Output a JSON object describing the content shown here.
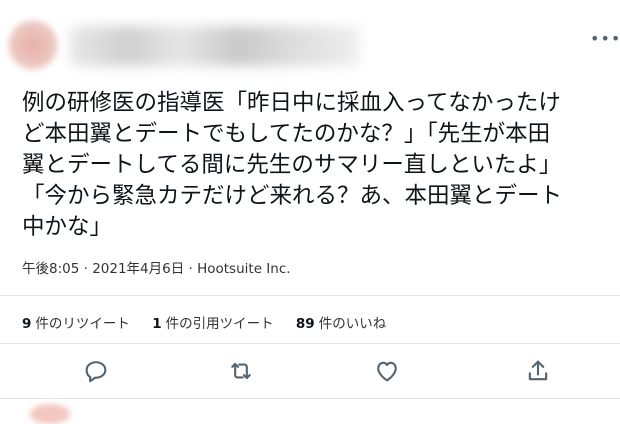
{
  "tweet": {
    "text_lines": [
      "例の研修医の指導医「昨日中に採血入ってなかったけ",
      "ど本田翼とデートでもしてたのかな？」「先生が本田",
      "翼とデートしてる間に先生のサマリー直しといたよ」",
      "「今から緊急カテだけど来れる？あ、本田翼とデート",
      "中かな」"
    ],
    "timestamp": "午後8:05 · 2021年4月6日 · Hootsuite Inc."
  },
  "stats": {
    "retweets": {
      "count": "9",
      "label": "件のリツイート"
    },
    "quotes": {
      "count": "1",
      "label": "件の引用ツイート"
    },
    "likes": {
      "count": "89",
      "label": "件のいいね"
    }
  },
  "icons": {
    "more": "more-icon",
    "reply": "reply-icon",
    "retweet": "retweet-icon",
    "like": "like-icon",
    "share": "share-icon"
  },
  "colors": {
    "icon": "#536471",
    "divider": "#e6e6e6"
  }
}
